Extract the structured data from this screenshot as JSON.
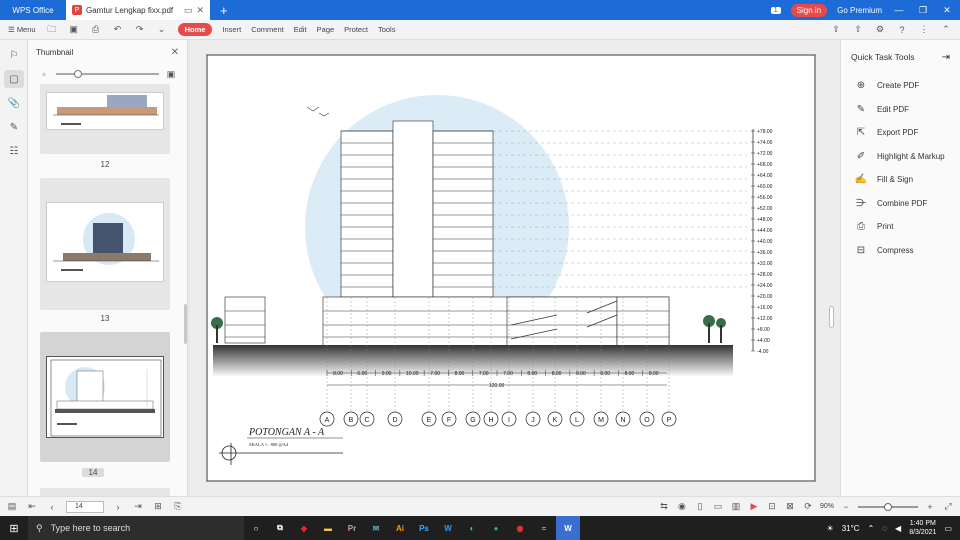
{
  "titlebar": {
    "app_label": "WPS Office",
    "doc_tab": "Gamtur Lengkap fixx.pdf",
    "pdf_icon": "P",
    "new_tab": "+",
    "badge": "1",
    "sign_in": "Sign in",
    "go_premium": "Go Premium"
  },
  "menu": {
    "menu_label": "Menu",
    "tabs": [
      "Home",
      "Insert",
      "Comment",
      "Edit",
      "Page",
      "Protect",
      "Tools"
    ]
  },
  "thumbnails": {
    "title": "Thumbnail",
    "pages": [
      {
        "number": "12"
      },
      {
        "number": "13"
      },
      {
        "number": "14"
      }
    ]
  },
  "drawing": {
    "title": "POTONGAN A - A",
    "scale": "SKALA 1 : 800 @A4",
    "levels": [
      "+78.00",
      "+74.00",
      "+72.00",
      "+68.00",
      "+64.00",
      "+60.00",
      "+56.00",
      "+52.00",
      "+48.00",
      "+44.00",
      "+40.00",
      "+36.00",
      "+32.00",
      "+28.00",
      "+24.00",
      "+20.00",
      "+16.00",
      "+12.00",
      "+8.00",
      "+4.00",
      "-4.00"
    ],
    "spans": [
      "8.00",
      "6.00",
      "9.00",
      "10.00",
      "7.00",
      "8.00",
      "7.00",
      "7.00",
      "8.00",
      "8.00",
      "8.00",
      "8.00",
      "8.00",
      "8.00"
    ],
    "total": "120.00",
    "grids": [
      "A",
      "B",
      "C",
      "D",
      "E",
      "F",
      "G",
      "H",
      "I",
      "J",
      "K",
      "L",
      "M",
      "N",
      "O",
      "P"
    ]
  },
  "tools": {
    "title": "Quick Task Tools",
    "items": [
      {
        "label": "Create PDF",
        "icon": "create-pdf-icon"
      },
      {
        "label": "Edit PDF",
        "icon": "edit-pdf-icon"
      },
      {
        "label": "Export PDF",
        "icon": "export-pdf-icon"
      },
      {
        "label": "Highlight & Markup",
        "icon": "highlight-icon"
      },
      {
        "label": "Fill & Sign",
        "icon": "sign-icon"
      },
      {
        "label": "Combine PDF",
        "icon": "combine-icon"
      },
      {
        "label": "Print",
        "icon": "print-icon"
      },
      {
        "label": "Compress",
        "icon": "compress-icon"
      }
    ]
  },
  "status": {
    "page_number": "14",
    "zoom": "90%"
  },
  "taskbar": {
    "search_placeholder": "Type here to search",
    "temperature": "31°C",
    "time": "1:40 PM",
    "date": "8/3/2021"
  }
}
